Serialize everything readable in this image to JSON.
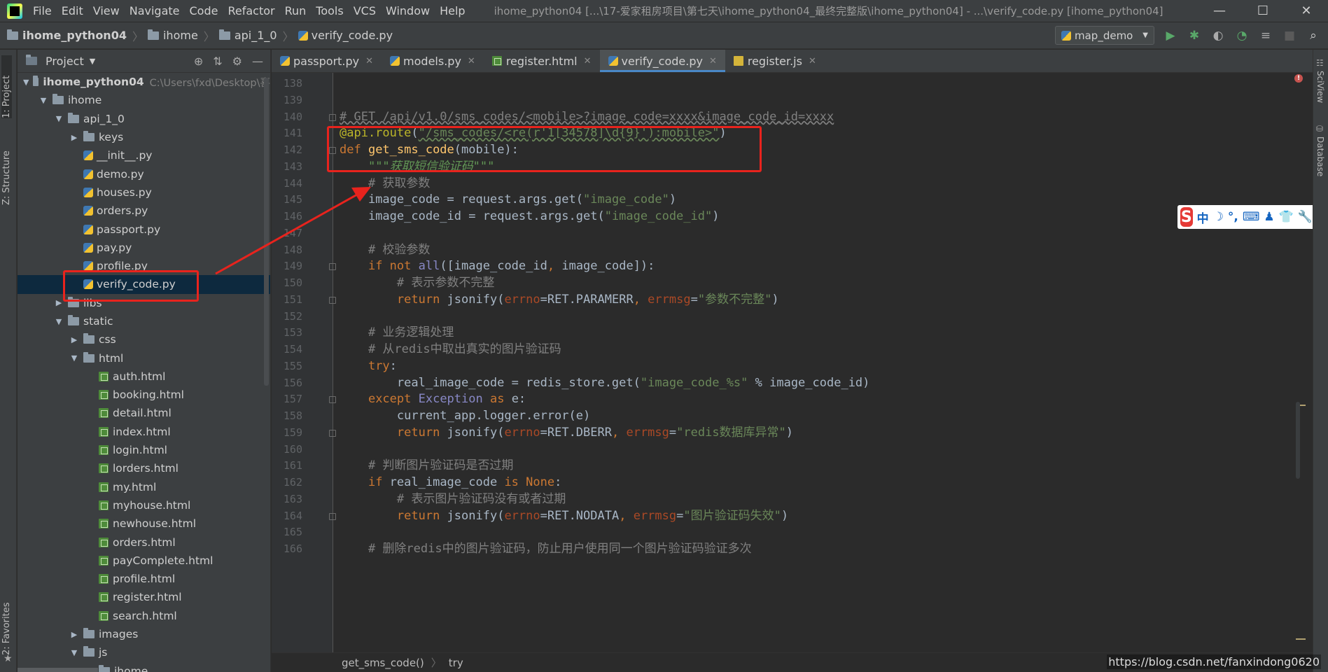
{
  "menubar": {
    "items": [
      "File",
      "Edit",
      "View",
      "Navigate",
      "Code",
      "Refactor",
      "Run",
      "Tools",
      "VCS",
      "Window",
      "Help"
    ],
    "window_title": "ihome_python04 [...\\17-爱家租房项目\\第七天\\ihome_python04_最终完整版\\ihome_python04] - ...\\verify_code.py [ihome_python04]",
    "minimize": "—",
    "maximize": "☐",
    "close": "✕"
  },
  "navbar": {
    "crumbs": [
      "ihome_python04",
      "ihome",
      "api_1_0",
      "verify_code.py"
    ],
    "run_config": "map_demo"
  },
  "left_strip": {
    "project_tab": "1: Project",
    "structure_tab": "Z: Structure",
    "favorites_tab": "2: Favorites"
  },
  "right_strip": {
    "sciview_tab": "SciView",
    "database_tab": "Database"
  },
  "project_panel": {
    "title": "Project",
    "tree": [
      {
        "label": "ihome_python04",
        "path": "C:\\Users\\fxd\\Desktop\\喜",
        "kind": "root",
        "depth": 0,
        "expanded": true
      },
      {
        "label": "ihome",
        "kind": "folder",
        "depth": 1,
        "expanded": true
      },
      {
        "label": "api_1_0",
        "kind": "folder",
        "depth": 2,
        "expanded": true
      },
      {
        "label": "keys",
        "kind": "folder",
        "depth": 3,
        "expanded": false
      },
      {
        "label": "__init__.py",
        "kind": "py",
        "depth": 3
      },
      {
        "label": "demo.py",
        "kind": "py",
        "depth": 3
      },
      {
        "label": "houses.py",
        "kind": "py",
        "depth": 3
      },
      {
        "label": "orders.py",
        "kind": "py",
        "depth": 3
      },
      {
        "label": "passport.py",
        "kind": "py",
        "depth": 3
      },
      {
        "label": "pay.py",
        "kind": "py",
        "depth": 3
      },
      {
        "label": "profile.py",
        "kind": "py",
        "depth": 3
      },
      {
        "label": "verify_code.py",
        "kind": "py",
        "depth": 3,
        "selected": true
      },
      {
        "label": "libs",
        "kind": "folder",
        "depth": 2,
        "expanded": false
      },
      {
        "label": "static",
        "kind": "folder",
        "depth": 2,
        "expanded": true
      },
      {
        "label": "css",
        "kind": "folder",
        "depth": 3,
        "expanded": false
      },
      {
        "label": "html",
        "kind": "folder",
        "depth": 3,
        "expanded": true
      },
      {
        "label": "auth.html",
        "kind": "html",
        "depth": 4
      },
      {
        "label": "booking.html",
        "kind": "html",
        "depth": 4
      },
      {
        "label": "detail.html",
        "kind": "html",
        "depth": 4
      },
      {
        "label": "index.html",
        "kind": "html",
        "depth": 4
      },
      {
        "label": "login.html",
        "kind": "html",
        "depth": 4
      },
      {
        "label": "lorders.html",
        "kind": "html",
        "depth": 4
      },
      {
        "label": "my.html",
        "kind": "html",
        "depth": 4
      },
      {
        "label": "myhouse.html",
        "kind": "html",
        "depth": 4
      },
      {
        "label": "newhouse.html",
        "kind": "html",
        "depth": 4
      },
      {
        "label": "orders.html",
        "kind": "html",
        "depth": 4
      },
      {
        "label": "payComplete.html",
        "kind": "html",
        "depth": 4
      },
      {
        "label": "profile.html",
        "kind": "html",
        "depth": 4
      },
      {
        "label": "register.html",
        "kind": "html",
        "depth": 4
      },
      {
        "label": "search.html",
        "kind": "html",
        "depth": 4
      },
      {
        "label": "images",
        "kind": "folder",
        "depth": 3,
        "expanded": false
      },
      {
        "label": "js",
        "kind": "folder",
        "depth": 3,
        "expanded": true
      },
      {
        "label": "ihome",
        "kind": "folder",
        "depth": 4,
        "expanded": true
      }
    ]
  },
  "tabs": [
    {
      "label": "passport.py",
      "kind": "py"
    },
    {
      "label": "models.py",
      "kind": "py"
    },
    {
      "label": "register.html",
      "kind": "html"
    },
    {
      "label": "verify_code.py",
      "kind": "py",
      "active": true
    },
    {
      "label": "register.js",
      "kind": "js"
    }
  ],
  "editor": {
    "lines": [
      {
        "n": 138,
        "tokens": []
      },
      {
        "n": 139,
        "tokens": []
      },
      {
        "n": 140,
        "tokens": [
          [
            "c-cm c-cmw",
            "# GET /api/v1.0/sms_codes/<mobile>?image_code=xxxx&image_code_id=xxxx"
          ]
        ]
      },
      {
        "n": 141,
        "tokens": [
          [
            "c-dec",
            "@api.route"
          ],
          [
            "",
            "("
          ],
          [
            "c-strr",
            "\"/sms_codes/<re(r'1[34578]\\d{9}'):mobile>\""
          ],
          [
            "",
            ")"
          ]
        ]
      },
      {
        "n": 142,
        "tokens": [
          [
            "c-kw",
            "def "
          ],
          [
            "c-fn",
            "get_sms_code"
          ],
          [
            "",
            "(mobile):"
          ]
        ]
      },
      {
        "n": 143,
        "tokens": [
          [
            "",
            "    "
          ],
          [
            "c-doc",
            "\"\"\"获取短信验证码\"\"\""
          ]
        ]
      },
      {
        "n": 144,
        "tokens": [
          [
            "",
            "    "
          ],
          [
            "c-cm",
            "# 获取参数"
          ]
        ]
      },
      {
        "n": 145,
        "tokens": [
          [
            "",
            "    image_code = request.args.get("
          ],
          [
            "c-str",
            "\"image_code\""
          ],
          [
            "",
            ")"
          ]
        ]
      },
      {
        "n": 146,
        "tokens": [
          [
            "",
            "    image_code_id = request.args.get("
          ],
          [
            "c-str",
            "\"image_code_id\""
          ],
          [
            "",
            ")"
          ]
        ]
      },
      {
        "n": 147,
        "tokens": []
      },
      {
        "n": 148,
        "tokens": [
          [
            "",
            "    "
          ],
          [
            "c-cm",
            "# 校验参数"
          ]
        ]
      },
      {
        "n": 149,
        "tokens": [
          [
            "",
            "    "
          ],
          [
            "c-kw",
            "if not "
          ],
          [
            "c-mag",
            "all"
          ],
          [
            "",
            "([image_code_id"
          ],
          [
            "c-kw",
            ", "
          ],
          [
            "",
            "image_code]):"
          ]
        ]
      },
      {
        "n": 150,
        "tokens": [
          [
            "",
            "        "
          ],
          [
            "c-cm",
            "# 表示参数不完整"
          ]
        ]
      },
      {
        "n": 151,
        "tokens": [
          [
            "",
            "        "
          ],
          [
            "c-kw",
            "return "
          ],
          [
            "",
            "jsonify("
          ],
          [
            "c-par",
            "errno"
          ],
          [
            "",
            "=RET.PARAMERR"
          ],
          [
            "c-kw",
            ", "
          ],
          [
            "c-par",
            "errmsg"
          ],
          [
            "",
            "="
          ],
          [
            "c-str",
            "\"参数不完整\""
          ],
          [
            "",
            ")"
          ]
        ]
      },
      {
        "n": 152,
        "tokens": []
      },
      {
        "n": 153,
        "tokens": [
          [
            "",
            "    "
          ],
          [
            "c-cm",
            "# 业务逻辑处理"
          ]
        ]
      },
      {
        "n": 154,
        "tokens": [
          [
            "",
            "    "
          ],
          [
            "c-cm",
            "# 从redis中取出真实的图片验证码"
          ]
        ]
      },
      {
        "n": 155,
        "tokens": [
          [
            "",
            "    "
          ],
          [
            "c-kw",
            "try"
          ],
          [
            "",
            ":"
          ]
        ]
      },
      {
        "n": 156,
        "tokens": [
          [
            "",
            "        real_image_code = redis_store.get("
          ],
          [
            "c-str",
            "\"image_code_%s\""
          ],
          [
            "",
            " % image_code_id)"
          ]
        ]
      },
      {
        "n": 157,
        "tokens": [
          [
            "",
            "    "
          ],
          [
            "c-kw",
            "except "
          ],
          [
            "c-cls",
            "Exception "
          ],
          [
            "c-kw",
            "as "
          ],
          [
            "",
            "e:"
          ]
        ]
      },
      {
        "n": 158,
        "tokens": [
          [
            "",
            "        current_app.logger.error(e)"
          ]
        ]
      },
      {
        "n": 159,
        "tokens": [
          [
            "",
            "        "
          ],
          [
            "c-kw",
            "return "
          ],
          [
            "",
            "jsonify("
          ],
          [
            "c-par",
            "errno"
          ],
          [
            "",
            "=RET.DBERR"
          ],
          [
            "c-kw",
            ", "
          ],
          [
            "c-par",
            "errmsg"
          ],
          [
            "",
            "="
          ],
          [
            "c-str",
            "\"redis数据库异常\""
          ],
          [
            "",
            ")"
          ]
        ]
      },
      {
        "n": 160,
        "tokens": []
      },
      {
        "n": 161,
        "tokens": [
          [
            "",
            "    "
          ],
          [
            "c-cm",
            "# 判断图片验证码是否过期"
          ]
        ]
      },
      {
        "n": 162,
        "tokens": [
          [
            "",
            "    "
          ],
          [
            "c-kw",
            "if "
          ],
          [
            "",
            "real_image_code "
          ],
          [
            "c-kw",
            "is None"
          ],
          [
            "",
            ":"
          ]
        ]
      },
      {
        "n": 163,
        "tokens": [
          [
            "",
            "        "
          ],
          [
            "c-cm",
            "# 表示图片验证码没有或者过期"
          ]
        ]
      },
      {
        "n": 164,
        "tokens": [
          [
            "",
            "        "
          ],
          [
            "c-kw",
            "return "
          ],
          [
            "",
            "jsonify("
          ],
          [
            "c-par",
            "errno"
          ],
          [
            "",
            "=RET.NODATA"
          ],
          [
            "c-kw",
            ", "
          ],
          [
            "c-par",
            "errmsg"
          ],
          [
            "",
            "="
          ],
          [
            "c-str",
            "\"图片验证码失效\""
          ],
          [
            "",
            ")"
          ]
        ]
      },
      {
        "n": 165,
        "tokens": []
      },
      {
        "n": 166,
        "tokens": [
          [
            "",
            "    "
          ],
          [
            "c-cm",
            "# 删除redis中的图片验证码，防止用户使用同一个图片验证码验证多次"
          ]
        ]
      }
    ]
  },
  "footer": {
    "crumbs": [
      "get_sms_code()",
      "try"
    ],
    "watermark": "https://blog.csdn.net/fanxindong0620"
  },
  "ime": {
    "logo": "S",
    "items": [
      "中",
      "☽",
      "°,",
      "⌨",
      "♟",
      "👕",
      "🔧"
    ]
  },
  "colors": {
    "annotation": "#e8231d",
    "accent": "#4a88c7",
    "background": "#2b2b2b",
    "panel": "#3c3f41"
  }
}
